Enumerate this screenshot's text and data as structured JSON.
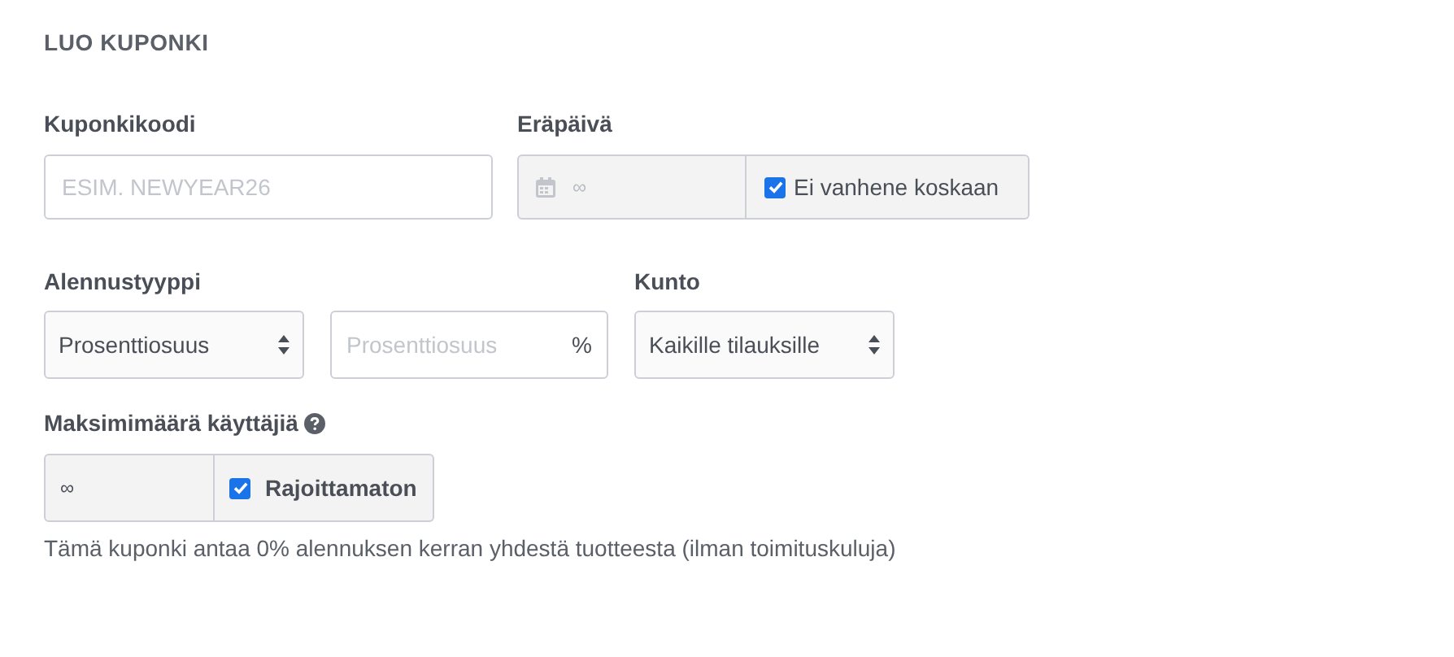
{
  "title": "LUO KUPONKI",
  "coupon_code": {
    "label": "Kuponkikoodi",
    "placeholder": "ESIM. NEWYEAR26"
  },
  "expiry": {
    "label": "Eräpäivä",
    "value": "∞",
    "disabled": true,
    "checkbox": {
      "label": "Ei vanhene koskaan",
      "checked": true
    }
  },
  "discount_type": {
    "label": "Alennustyyppi",
    "value": "Prosenttiosuus"
  },
  "discount_amount": {
    "placeholder": "Prosenttiosuus",
    "suffix": "%"
  },
  "condition": {
    "label": "Kunto",
    "value": "Kaikille tilauksille"
  },
  "max_users": {
    "label": "Maksimimäärä käyttäjiä",
    "value": "∞",
    "disabled": true,
    "checkbox": {
      "label": "Rajoittamaton",
      "checked": true
    }
  },
  "summary": "Tämä kuponki antaa 0% alennuksen kerran yhdestä tuotteesta (ilman toimituskuluja)"
}
